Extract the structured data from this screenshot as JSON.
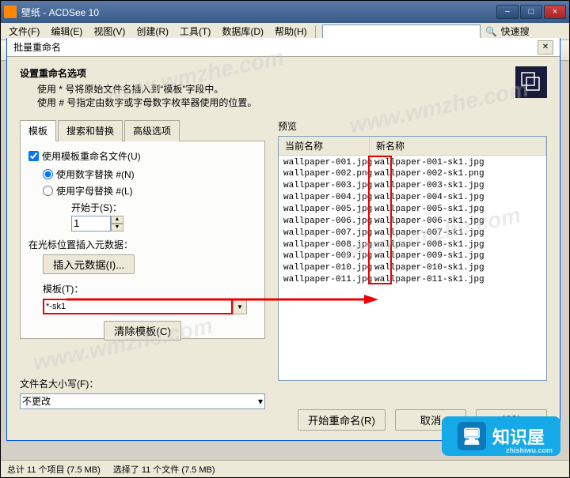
{
  "window": {
    "title": "壁纸 - ACDSee 10",
    "menubar": [
      "文件(F)",
      "编辑(E)",
      "视图(V)",
      "创建(R)",
      "工具(T)",
      "数据库(D)",
      "帮助(H)"
    ],
    "quick_search": "快速搜"
  },
  "dialog": {
    "title": "批量重命名",
    "header_title": "设置重命名选项",
    "header_line1": "使用 * 号将原始文件名插入到“模板”字段中。",
    "header_line2": "使用 # 号指定由数字或字母数字枚举器使用的位置。"
  },
  "tabs": [
    "模板",
    "搜索和替换",
    "高级选项"
  ],
  "options": {
    "use_template_label": "使用模板重命名文件(U)",
    "use_numeric_label": "使用数字替换 #(N)",
    "use_alpha_label": "使用字母替换 #(L)",
    "start_at_label": "开始于(S)：",
    "start_at_value": "1",
    "cursor_insert_label": "在光标位置插入元数据：",
    "insert_button": "插入元数据(I)...",
    "template_label": "模板(T)：",
    "template_value": "*-sk1",
    "clear_button": "清除模板(C)"
  },
  "case": {
    "label": "文件名大小写(F)：",
    "value": "不更改"
  },
  "preview": {
    "label": "预览",
    "col_current": "当前名称",
    "col_new": "新名称",
    "rows": [
      {
        "current": "wallpaper-001.jpg",
        "new": "wallpaper-001-sk1.jpg"
      },
      {
        "current": "wallpaper-002.png",
        "new": "wallpaper-002-sk1.png"
      },
      {
        "current": "wallpaper-003.jpg",
        "new": "wallpaper-003-sk1.jpg"
      },
      {
        "current": "wallpaper-004.jpg",
        "new": "wallpaper-004-sk1.jpg"
      },
      {
        "current": "wallpaper-005.jpg",
        "new": "wallpaper-005-sk1.jpg"
      },
      {
        "current": "wallpaper-006.jpg",
        "new": "wallpaper-006-sk1.jpg"
      },
      {
        "current": "wallpaper-007.jpg",
        "new": "wallpaper-007-sk1.jpg"
      },
      {
        "current": "wallpaper-008.jpg",
        "new": "wallpaper-008-sk1.jpg"
      },
      {
        "current": "wallpaper-009.jpg",
        "new": "wallpaper-009-sk1.jpg"
      },
      {
        "current": "wallpaper-010.jpg",
        "new": "wallpaper-010-sk1.jpg"
      },
      {
        "current": "wallpaper-011.jpg",
        "new": "wallpaper-011-sk1.jpg"
      }
    ]
  },
  "footer": {
    "start": "开始重命名(R)",
    "cancel": "取消",
    "help": "帮助"
  },
  "statusbar": {
    "total": "总计 11 个项目 (7.5 MB)",
    "selected": "选择了 11 个文件 (7.5 MB)"
  },
  "logo": {
    "text": "知识屋",
    "sub": "zhishiwu.com"
  },
  "watermark": "www.wmzhe.com"
}
